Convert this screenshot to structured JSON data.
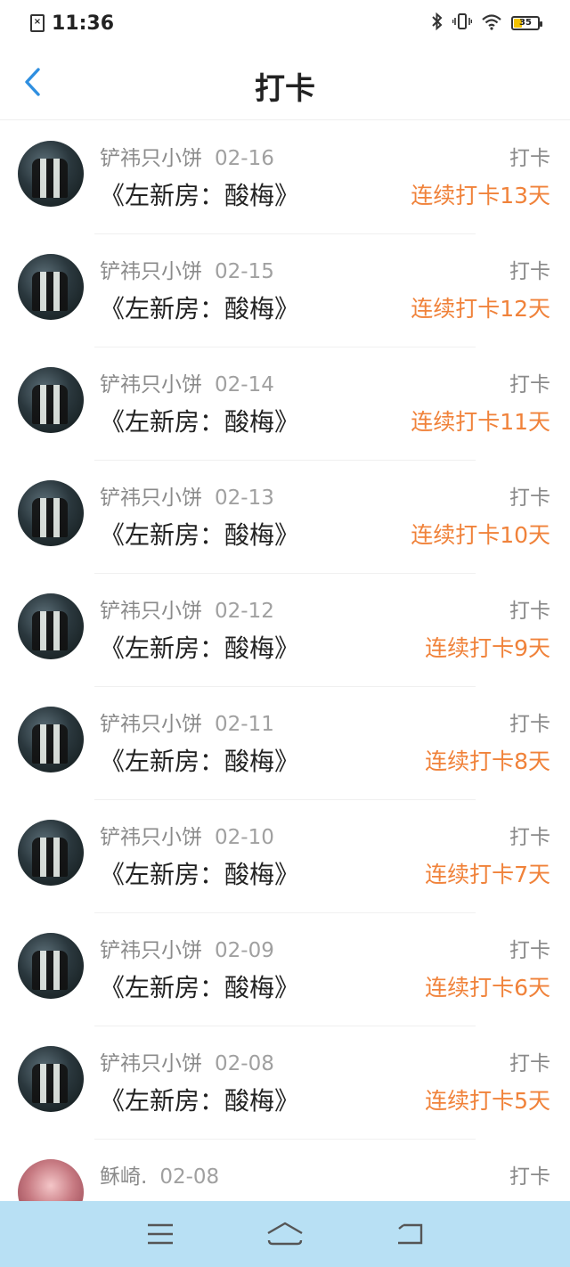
{
  "status_bar": {
    "time": "11:36",
    "battery": "35",
    "battery_level_percent": 35
  },
  "header": {
    "title": "打卡"
  },
  "entries": [
    {
      "user": "铲祎只小饼",
      "date": "02-16",
      "book": "《左新房：酸梅》",
      "action": "打卡",
      "streak": "连续打卡13天"
    },
    {
      "user": "铲祎只小饼",
      "date": "02-15",
      "book": "《左新房：酸梅》",
      "action": "打卡",
      "streak": "连续打卡12天"
    },
    {
      "user": "铲祎只小饼",
      "date": "02-14",
      "book": "《左新房：酸梅》",
      "action": "打卡",
      "streak": "连续打卡11天"
    },
    {
      "user": "铲祎只小饼",
      "date": "02-13",
      "book": "《左新房：酸梅》",
      "action": "打卡",
      "streak": "连续打卡10天"
    },
    {
      "user": "铲祎只小饼",
      "date": "02-12",
      "book": "《左新房：酸梅》",
      "action": "打卡",
      "streak": "连续打卡9天"
    },
    {
      "user": "铲祎只小饼",
      "date": "02-11",
      "book": "《左新房：酸梅》",
      "action": "打卡",
      "streak": "连续打卡8天"
    },
    {
      "user": "铲祎只小饼",
      "date": "02-10",
      "book": "《左新房：酸梅》",
      "action": "打卡",
      "streak": "连续打卡7天"
    },
    {
      "user": "铲祎只小饼",
      "date": "02-09",
      "book": "《左新房：酸梅》",
      "action": "打卡",
      "streak": "连续打卡6天"
    },
    {
      "user": "铲祎只小饼",
      "date": "02-08",
      "book": "《左新房：酸梅》",
      "action": "打卡",
      "streak": "连续打卡5天"
    },
    {
      "user": "稣崎.",
      "date": "02-08",
      "book": "",
      "action": "打卡",
      "streak": ""
    }
  ],
  "colors": {
    "accent": "#f0823a",
    "back": "#2f8fe0",
    "nav_bar": "#b8e0f4"
  }
}
